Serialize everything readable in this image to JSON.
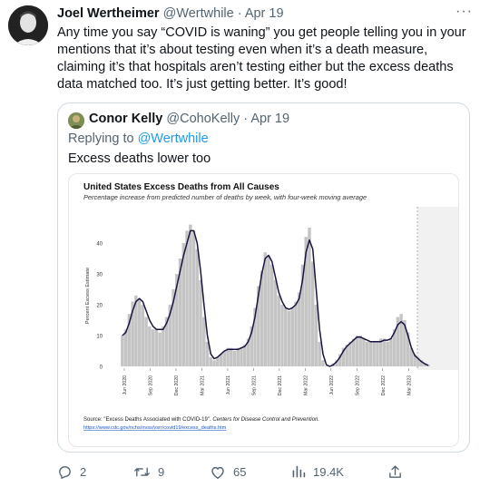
{
  "tweet": {
    "author_name": "Joel Wertheimer",
    "author_handle": "@Wertwhile",
    "date": "Apr 19",
    "more": "···",
    "text": "Any time you say “COVID is waning” you get people telling you in your mentions that it’s about testing even when it’s a death measure, claiming it’s that hospitals aren’t testing either but the excess deaths data matched too. It’s just getting better. It’s good!"
  },
  "quote": {
    "author_name": "Conor Kelly",
    "author_handle": "@CohoKelly",
    "date": "Apr 19",
    "replying_prefix": "Replying to ",
    "replying_to": "@Wertwhile",
    "text": "Excess deaths lower too"
  },
  "chart_data": {
    "type": "bar",
    "title": "United States Excess Deaths from All Causes",
    "subtitle": "Percentage increase from predicted number of deaths by week, with four-week moving average",
    "ylabel": "Percent Excess Estimate",
    "ylim": [
      -1,
      47
    ],
    "yticks": [
      0,
      10,
      20,
      30,
      40
    ],
    "x_tick_labels": [
      "Jun 2020",
      "Sep 2020",
      "Dec 2020",
      "Mar 2021",
      "Jun 2021",
      "Sep 2021",
      "Dec 2021",
      "Mar 2022",
      "Jun 2022",
      "Sep 2022",
      "Dec 2022",
      "Mar 2023"
    ],
    "source_prefix": "Source: \"Excess Deaths Associated with COVID-19\". ",
    "source_italic": "Centers for Disease Control and Prevention.",
    "source_url": "https://www.cdc.gov/nchs/nvss/vsrr/covid19/excess_deaths.htm",
    "bar_color": "#c4c4c4",
    "line_color": "#1c1340",
    "shaded_region_color": "#f1f1f1",
    "weekly_values": [
      10,
      12,
      17,
      21,
      23,
      22,
      20,
      16,
      13,
      12,
      12,
      11,
      13,
      16,
      20,
      25,
      30,
      35,
      40,
      44,
      46,
      44,
      38,
      28,
      16,
      8,
      3,
      2,
      3,
      4,
      5,
      6,
      6,
      5,
      6,
      6,
      7,
      9,
      13,
      19,
      26,
      31,
      37,
      36,
      33,
      28,
      23,
      20,
      19,
      18,
      19,
      21,
      24,
      33,
      42,
      45,
      34,
      20,
      8,
      2,
      0,
      0,
      1,
      2,
      4,
      6,
      7,
      8,
      9,
      10,
      10,
      9,
      8,
      8,
      8,
      8,
      9,
      9,
      8,
      9,
      12,
      16,
      17,
      15,
      11,
      6,
      4,
      3,
      2,
      1,
      0.5
    ],
    "moving_average": [
      10,
      11,
      14,
      18,
      21,
      22,
      21,
      18,
      15,
      13,
      12,
      12,
      12,
      14,
      17,
      21,
      26,
      31,
      36,
      40,
      44,
      44,
      40,
      31,
      20,
      10,
      4,
      2.5,
      3,
      4,
      5,
      5.5,
      5.5,
      5.5,
      5.5,
      6,
      6.5,
      8,
      11,
      16,
      23,
      30,
      35,
      36,
      34,
      29,
      24,
      21,
      19,
      18.5,
      19,
      20,
      22,
      28,
      37,
      41,
      38,
      25,
      12,
      4,
      0.5,
      0,
      0.5,
      1.5,
      3,
      5,
      6.5,
      7.5,
      8.5,
      9.5,
      9.5,
      9,
      8.5,
      8,
      8,
      8,
      8,
      8.5,
      8.5,
      9,
      11,
      13.5,
      14.5,
      13.5,
      10,
      6,
      3.5,
      2.5,
      1.5,
      0.8,
      0.3
    ]
  },
  "actions": {
    "replies": "2",
    "retweets": "9",
    "likes": "65",
    "views": "19.4K"
  }
}
